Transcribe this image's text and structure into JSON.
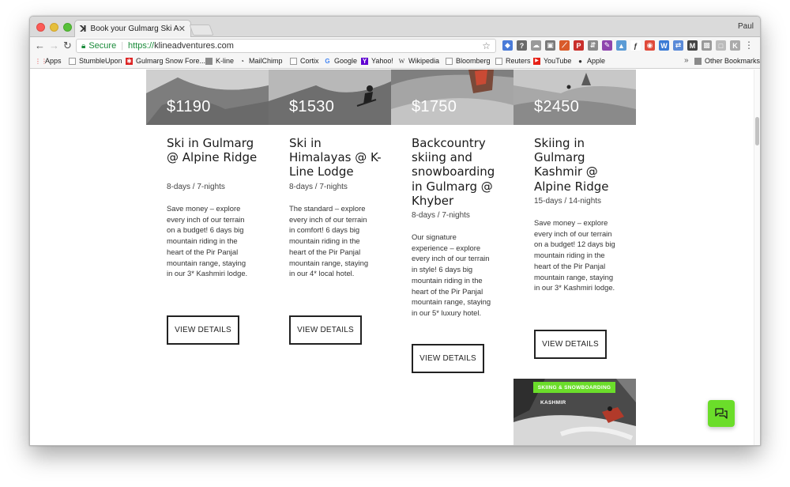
{
  "browser": {
    "tab_title": "Book your Gulmarg Ski Adven",
    "tab_logo": "ꓘ",
    "tab_close": "✕",
    "user": "Paul",
    "secure_label": "Secure",
    "url_scheme": "https://",
    "url_host": "klineadventures.com"
  },
  "bookmarks": {
    "items": [
      {
        "label": "Apps",
        "icon": "apps-grid-icon"
      },
      {
        "label": "StumbleUpon",
        "icon": "page-icon"
      },
      {
        "label": "Gulmarg Snow Fore...",
        "icon": "gulmarg-icon"
      },
      {
        "label": "K-line",
        "icon": "folder-icon"
      },
      {
        "label": "MailChimp",
        "icon": "mailchimp-icon"
      },
      {
        "label": "Cortix",
        "icon": "page-icon"
      },
      {
        "label": "Google",
        "icon": "google-icon"
      },
      {
        "label": "Yahoo!",
        "icon": "yahoo-icon"
      },
      {
        "label": "Wikipedia",
        "icon": "wikipedia-icon"
      },
      {
        "label": "Bloomberg",
        "icon": "page-icon"
      },
      {
        "label": "Reuters",
        "icon": "page-icon"
      },
      {
        "label": "YouTube",
        "icon": "youtube-icon"
      },
      {
        "label": "Apple",
        "icon": "apple-icon"
      }
    ],
    "chevron": "»",
    "other": "Other Bookmarks"
  },
  "cards": [
    {
      "price": "$1190",
      "title": "Ski in Gulmarg @ Alpine Ridge",
      "duration": "8-days / 7-nights",
      "description": "Save money – explore every inch of our terrain on a budget! 6 days big mountain riding in the heart of the Pir Panjal mountain range, staying in our 3* Kashmiri lodge.",
      "button": "VIEW DETAILS"
    },
    {
      "price": "$1530",
      "title": "Ski in Himalayas @ K-Line Lodge",
      "duration": "8-days / 7-nights",
      "description": "The standard – explore every inch of our terrain in comfort! 6 days big mountain riding in the heart of the Pir Panjal mountain range, staying in our 4* local hotel.",
      "button": "VIEW DETAILS"
    },
    {
      "price": "$1750",
      "title": "Backcountry skiing and snowboarding in Gulmarg @ Khyber",
      "duration": "8-days / 7-nights",
      "description": "Our signature experience – explore every inch of our terrain in style! 6 days big mountain riding in the heart of the Pir Panjal mountain range, staying in our 5* luxury hotel.",
      "button": "VIEW DETAILS"
    },
    {
      "price": "$2450",
      "title": "Skiing in Gulmarg Kashmir @ Alpine Ridge",
      "duration": "15-days / 14-nights",
      "description": "Save money – explore every inch of our terrain on a budget! 12 days big mountain riding in the heart of the Pir Panjal mountain range, staying in our 3* Kashmiri lodge.",
      "button": "VIEW DETAILS"
    }
  ],
  "promo": {
    "tag": "SKIING & SNOWBOARDING",
    "place": "KASHMIR"
  },
  "colors": {
    "accent_green": "#6bdd2a"
  }
}
